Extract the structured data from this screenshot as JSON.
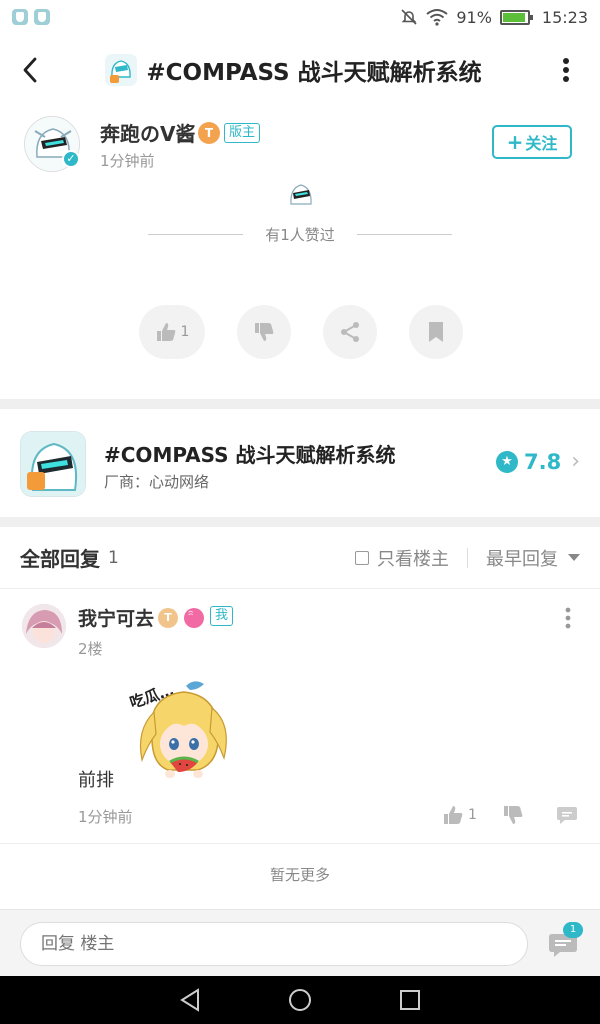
{
  "status_bar": {
    "battery": "91%",
    "time": "15:23"
  },
  "header": {
    "title": "#COMPASS 战斗天赋解析系统"
  },
  "author": {
    "name": "奔跑のV酱",
    "level_badge": "T",
    "role_badge": "版主",
    "time": "1分钟前",
    "follow_label": "关注",
    "follow_plus": "+"
  },
  "likes": {
    "summary": "有1人赞过"
  },
  "actions": {
    "like_count": "1"
  },
  "app_card": {
    "name": "#COMPASS 战斗天赋解析系统",
    "developer": "厂商：心动网络",
    "rating": "7.8"
  },
  "replies": {
    "title": "全部回复",
    "count": "1",
    "only_op_label": "只看楼主",
    "sort_label": "最早回复"
  },
  "reply": {
    "user": "我宁可去",
    "level_badge": "T",
    "me_badge": "我",
    "floor": "2楼",
    "sticker_text": "吃瓜…",
    "text": "前排",
    "time": "1分钟前",
    "like_count": "1"
  },
  "no_more": "暂无更多",
  "input": {
    "placeholder": "回复 楼主"
  },
  "notification_count": "1",
  "colors": {
    "accent": "#2eb8c8"
  }
}
